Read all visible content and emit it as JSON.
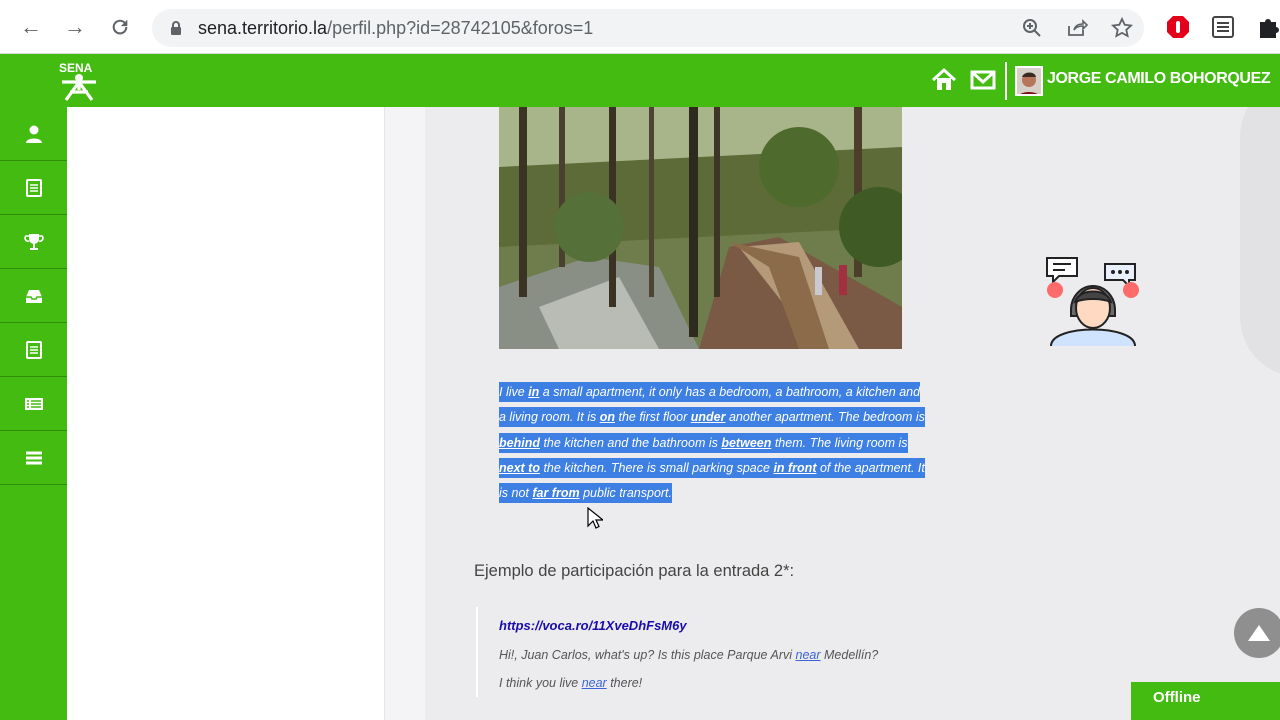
{
  "browser": {
    "url_host": "sena.territorio.la",
    "url_path": "/perfil.php?id=28742105&foros=1"
  },
  "header": {
    "logo_text": "SENA",
    "user_name": "JORGE CAMILO BOHORQUEZ"
  },
  "sidebar": {
    "items": [
      {
        "icon": "user-icon"
      },
      {
        "icon": "book-icon"
      },
      {
        "icon": "trophy-icon"
      },
      {
        "icon": "inbox-icon"
      },
      {
        "icon": "notebook-icon"
      },
      {
        "icon": "list-icon"
      },
      {
        "icon": "menu-icon"
      }
    ]
  },
  "post": {
    "paragraph": {
      "s1": "I live ",
      "w1": "in",
      "s2": " a small apartment, it only has a bedroom, a bathroom, a kitchen and a living room. It is ",
      "w2": "on",
      "s3": " the first floor ",
      "w3": "under",
      "s4": " another apartment. The bedroom is ",
      "w4": "behind",
      "s5": " the kitchen and the bathroom is ",
      "w5": "between",
      "s6": " them. The living room is ",
      "w6": "next to",
      "s7": " the kitchen. There is small parking space ",
      "w7": "in front",
      "s8": " of the apartment.  It is not ",
      "w8": "far from",
      "s9": " public transport."
    },
    "section_title": "Ejemplo de participación para la entrada 2*:",
    "audio_link": "https://voca.ro/11XveDhFsM6y",
    "line1_a": "Hi!, Juan Carlos, what's up? Is this place Parque Arvi ",
    "line1_link": "near",
    "line1_b": " Medellín?",
    "line2_a": "I think you live ",
    "line2_link": "near",
    "line2_b": " there!"
  },
  "status": {
    "offline_label": "Offline"
  },
  "colors": {
    "brand_green": "#43bb11",
    "selection_blue": "#3d7fe3"
  }
}
